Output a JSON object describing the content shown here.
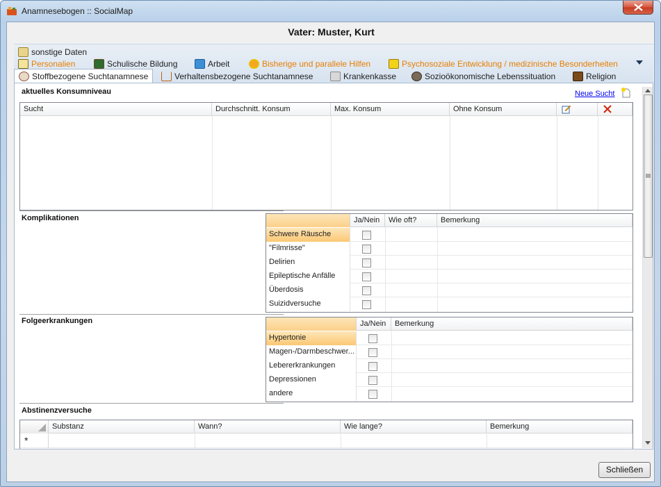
{
  "window": {
    "title": "Anamnesebogen :: SocialMap"
  },
  "header": {
    "person": "Vater: Muster, Kurt"
  },
  "tabs": {
    "row1": [
      {
        "label": "sonstige Daten",
        "icon": "clipboard-icon",
        "color": "#1e1e1e"
      }
    ],
    "row2": [
      {
        "label": "Personalien",
        "icon": "id-card-icon",
        "color": "#e67e00"
      },
      {
        "label": "Schulische Bildung",
        "icon": "chalkboard-icon",
        "color": "#1e1e1e"
      },
      {
        "label": "Arbeit",
        "icon": "work-icon",
        "color": "#1e1e1e"
      },
      {
        "label": "Bisherige und parallele Hilfen",
        "icon": "lifebuoy-icon",
        "color": "#e67e00"
      },
      {
        "label": "Psychosoziale Entwicklung / medizinische Besonderheiten",
        "icon": "people-icon",
        "color": "#e67e00"
      }
    ],
    "row3": [
      {
        "label": "Stoffbezogene Suchtanamnese",
        "icon": "skull-icon",
        "active": true
      },
      {
        "label": "Verhaltensbezogene Suchtanamnese",
        "icon": "cart-icon"
      },
      {
        "label": "Krankenkasse",
        "icon": "building-icon"
      },
      {
        "label": "Sozioökonomische Lebenssituation",
        "icon": "people-icon"
      },
      {
        "label": "Religion",
        "icon": "book-icon"
      }
    ]
  },
  "konsum": {
    "title": "aktuelles Konsumniveau",
    "new_link": "Neue Sucht",
    "columns": [
      "Sucht",
      "Durchschnitt. Konsum",
      "Max. Konsum",
      "Ohne Konsum"
    ]
  },
  "komplikationen": {
    "title": "Komplikationen",
    "columns": [
      "Ja/Nein",
      "Wie oft?",
      "Bemerkung"
    ],
    "rows": [
      "Schwere Räusche",
      "\"Filmrisse\"",
      "Delirien",
      "Epileptische Anfälle",
      "Überdosis",
      "Suizidversuche"
    ],
    "selected_row": 0
  },
  "folge": {
    "title": "Folgeerkrankungen",
    "columns": [
      "Ja/Nein",
      "Bemerkung"
    ],
    "rows": [
      "Hypertonie",
      "Magen-/Darmbeschwer...",
      "Lebererkrankungen",
      "Depressionen",
      "andere"
    ],
    "selected_row": 0
  },
  "abstinenz": {
    "title": "Abstinenzversuche",
    "columns": [
      "Substanz",
      "Wann?",
      "Wie lange?",
      "Bemerkung"
    ],
    "new_row_marker": "*"
  },
  "footer": {
    "close_label": "Schließen"
  },
  "colors": {
    "accent_orange": "#e67e00",
    "selected_row": "#fcc874",
    "delete_red": "#d22a12"
  }
}
